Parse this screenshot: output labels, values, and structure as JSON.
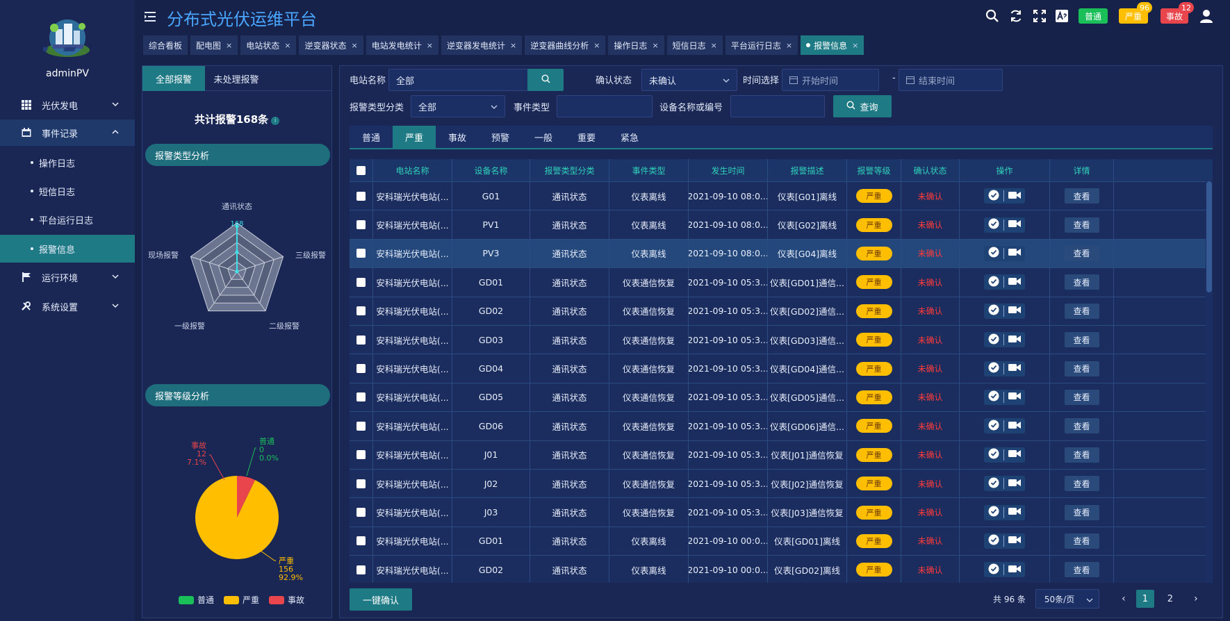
{
  "app": {
    "title": "分布式光伏运维平台",
    "username": "adminPV"
  },
  "sidebar": {
    "groups": [
      {
        "label": "光伏发电",
        "icon": "grid-icon"
      },
      {
        "label": "事件记录",
        "icon": "calendar-icon"
      },
      {
        "label": "运行环境",
        "icon": "flag-icon"
      },
      {
        "label": "系统设置",
        "icon": "tools-icon"
      }
    ],
    "event_sub_items": [
      "操作日志",
      "短信日志",
      "平台运行日志",
      "报警信息"
    ],
    "selected_sub_item": "报警信息"
  },
  "header": {
    "badges": [
      {
        "label": "普通",
        "color": "#1bbf5a",
        "count": ""
      },
      {
        "label": "严重",
        "color": "#ffbe00",
        "count": "96"
      },
      {
        "label": "事故",
        "color": "#e8454c",
        "count": "12"
      }
    ]
  },
  "tabs": [
    {
      "label": "综合看板",
      "closable": false
    },
    {
      "label": "配电图",
      "closable": true
    },
    {
      "label": "电站状态",
      "closable": true
    },
    {
      "label": "逆变器状态",
      "closable": true
    },
    {
      "label": "电站发电统计",
      "closable": true
    },
    {
      "label": "逆变器发电统计",
      "closable": true
    },
    {
      "label": "逆变器曲线分析",
      "closable": true
    },
    {
      "label": "操作日志",
      "closable": true
    },
    {
      "label": "短信日志",
      "closable": true
    },
    {
      "label": "平台运行日志",
      "closable": true
    },
    {
      "label": "报警信息",
      "closable": true,
      "active": true
    }
  ],
  "left_panel": {
    "tabs": [
      "全部报警",
      "未处理报警"
    ],
    "total_label": "共计报警168条",
    "type_section": "报警类型分析",
    "level_section": "报警等级分析"
  },
  "chart_data": [
    {
      "type": "radar",
      "indicators": [
        "通讯状态",
        "三级报警",
        "二级报警",
        "一级报警",
        "现场报警"
      ],
      "max_label": "168",
      "values": [
        0.93,
        0.0,
        0.0,
        0.0,
        0.0
      ]
    },
    {
      "type": "pie",
      "slices": [
        {
          "name": "普通",
          "value": 0,
          "percent": "0.0%",
          "color": "#1bbf5a"
        },
        {
          "name": "严重",
          "value": 156,
          "percent": "92.9%",
          "color": "#ffbe00"
        },
        {
          "name": "事故",
          "value": 12,
          "percent": "7.1%",
          "color": "#e8454c"
        }
      ]
    }
  ],
  "filters": {
    "station_label": "电站名称",
    "station_value": "全部",
    "confirm_label": "确认状态",
    "confirm_value": "未确认",
    "time_label": "时间选择",
    "start_placeholder": "开始时间",
    "dash": "-",
    "end_placeholder": "结束时间",
    "type_label": "报警类型分类",
    "type_value": "全部",
    "event_label": "事件类型",
    "device_label": "设备名称或编号",
    "query_label": "查询"
  },
  "level_tabs": [
    "普通",
    "严重",
    "事故",
    "预警",
    "一般",
    "重要",
    "紧急"
  ],
  "active_level_tab": "严重",
  "table": {
    "columns": [
      "电站名称",
      "设备名称",
      "报警类型分类",
      "事件类型",
      "发生时间",
      "报警描述",
      "报警等级",
      "确认状态",
      "操作",
      "详情"
    ],
    "rows": [
      {
        "station": "安科瑞光伏电站(...",
        "device": "G01",
        "category": "通讯状态",
        "event": "仪表离线",
        "time": "2021-09-10 08:0...",
        "desc": "仪表[G01]离线",
        "level": "严重",
        "status": "未确认",
        "detail": "查看"
      },
      {
        "station": "安科瑞光伏电站(...",
        "device": "PV1",
        "category": "通讯状态",
        "event": "仪表离线",
        "time": "2021-09-10 08:0...",
        "desc": "仪表[G02]离线",
        "level": "严重",
        "status": "未确认",
        "detail": "查看"
      },
      {
        "station": "安科瑞光伏电站(...",
        "device": "PV3",
        "category": "通讯状态",
        "event": "仪表离线",
        "time": "2021-09-10 08:0...",
        "desc": "仪表[G04]离线",
        "level": "严重",
        "status": "未确认",
        "detail": "查看"
      },
      {
        "station": "安科瑞光伏电站(...",
        "device": "GD01",
        "category": "通讯状态",
        "event": "仪表通信恢复",
        "time": "2021-09-10 05:3...",
        "desc": "仪表[GD01]通信...",
        "level": "严重",
        "status": "未确认",
        "detail": "查看"
      },
      {
        "station": "安科瑞光伏电站(...",
        "device": "GD02",
        "category": "通讯状态",
        "event": "仪表通信恢复",
        "time": "2021-09-10 05:3...",
        "desc": "仪表[GD02]通信...",
        "level": "严重",
        "status": "未确认",
        "detail": "查看"
      },
      {
        "station": "安科瑞光伏电站(...",
        "device": "GD03",
        "category": "通讯状态",
        "event": "仪表通信恢复",
        "time": "2021-09-10 05:3...",
        "desc": "仪表[GD03]通信...",
        "level": "严重",
        "status": "未确认",
        "detail": "查看"
      },
      {
        "station": "安科瑞光伏电站(...",
        "device": "GD04",
        "category": "通讯状态",
        "event": "仪表通信恢复",
        "time": "2021-09-10 05:3...",
        "desc": "仪表[GD04]通信...",
        "level": "严重",
        "status": "未确认",
        "detail": "查看"
      },
      {
        "station": "安科瑞光伏电站(...",
        "device": "GD05",
        "category": "通讯状态",
        "event": "仪表通信恢复",
        "time": "2021-09-10 05:3...",
        "desc": "仪表[GD05]通信...",
        "level": "严重",
        "status": "未确认",
        "detail": "查看"
      },
      {
        "station": "安科瑞光伏电站(...",
        "device": "GD06",
        "category": "通讯状态",
        "event": "仪表通信恢复",
        "time": "2021-09-10 05:3...",
        "desc": "仪表[GD06]通信...",
        "level": "严重",
        "status": "未确认",
        "detail": "查看"
      },
      {
        "station": "安科瑞光伏电站(...",
        "device": "J01",
        "category": "通讯状态",
        "event": "仪表通信恢复",
        "time": "2021-09-10 05:3...",
        "desc": "仪表[J01]通信恢复",
        "level": "严重",
        "status": "未确认",
        "detail": "查看"
      },
      {
        "station": "安科瑞光伏电站(...",
        "device": "J02",
        "category": "通讯状态",
        "event": "仪表通信恢复",
        "time": "2021-09-10 05:3...",
        "desc": "仪表[J02]通信恢复",
        "level": "严重",
        "status": "未确认",
        "detail": "查看"
      },
      {
        "station": "安科瑞光伏电站(...",
        "device": "J03",
        "category": "通讯状态",
        "event": "仪表通信恢复",
        "time": "2021-09-10 05:3...",
        "desc": "仪表[J03]通信恢复",
        "level": "严重",
        "status": "未确认",
        "detail": "查看"
      },
      {
        "station": "安科瑞光伏电站(...",
        "device": "GD01",
        "category": "通讯状态",
        "event": "仪表离线",
        "time": "2021-09-10 00:0...",
        "desc": "仪表[GD01]离线",
        "level": "严重",
        "status": "未确认",
        "detail": "查看"
      },
      {
        "station": "安科瑞光伏电站(...",
        "device": "GD02",
        "category": "通讯状态",
        "event": "仪表离线",
        "time": "2021-09-10 00:0...",
        "desc": "仪表[GD02]离线",
        "level": "严重",
        "status": "未确认",
        "detail": "查看"
      }
    ],
    "highlighted_row": 2
  },
  "footer": {
    "confirm_all": "一键确认",
    "total": "共 96 条",
    "page_size": "50条/页",
    "pages": [
      "1",
      "2"
    ],
    "current_page": "1"
  },
  "colors": {
    "accent": "#1e7a85",
    "title": "#4aa6ff",
    "severe": "#ffbe00",
    "danger": "#ff3b3b"
  }
}
